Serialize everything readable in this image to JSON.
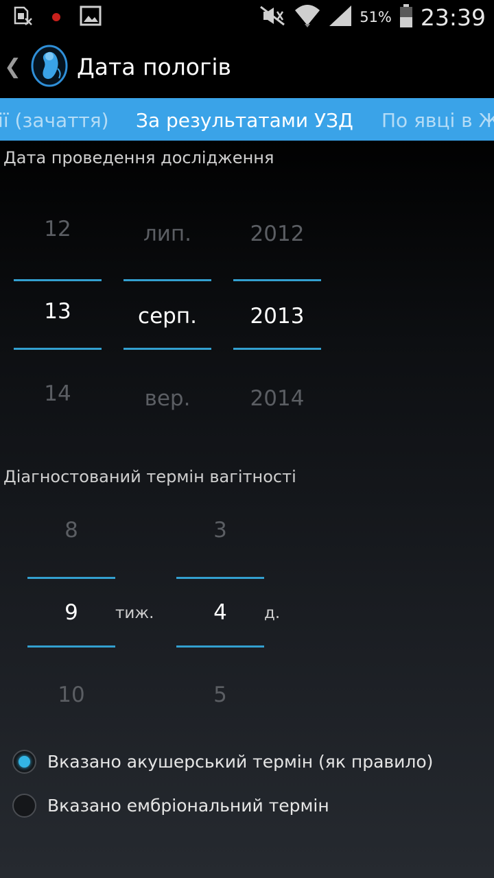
{
  "status_bar": {
    "time": "23:39",
    "battery_percent": "51%",
    "icons": [
      "sim-card-icon",
      "recording-dot-icon",
      "image-icon",
      "mute-icon",
      "wifi-icon",
      "signal-icon",
      "battery-icon"
    ]
  },
  "action_bar": {
    "back_glyph": "❮",
    "title": "Дата пологів",
    "icon": "fetus-icon"
  },
  "tabs": [
    {
      "label": "ції (зачаття)",
      "active": false
    },
    {
      "label": "За результатами УЗД",
      "active": true
    },
    {
      "label": "По явці в Ж",
      "active": false
    }
  ],
  "exam_date": {
    "label": "Дата проведення дослідження",
    "day": {
      "prev": "12",
      "selected": "13",
      "next": "14"
    },
    "month": {
      "prev": "лип.",
      "selected": "серп.",
      "next": "вер."
    },
    "year": {
      "prev": "2012",
      "selected": "2013",
      "next": "2014"
    }
  },
  "gestation": {
    "label": "Діагностований термін вагітності",
    "weeks": {
      "prev": "8",
      "selected": "9",
      "next": "10",
      "unit": "тиж."
    },
    "days": {
      "prev": "3",
      "selected": "4",
      "next": "5",
      "unit": "д."
    }
  },
  "term_type": {
    "options": [
      {
        "label": "Вказано акушерський термін (як правило)",
        "checked": true
      },
      {
        "label": "Вказано ембріональний термін",
        "checked": false
      }
    ]
  },
  "colors": {
    "accent": "#33b5e5",
    "tab_bar": "#3aa3e8",
    "picker_line": "#33a0d0"
  }
}
